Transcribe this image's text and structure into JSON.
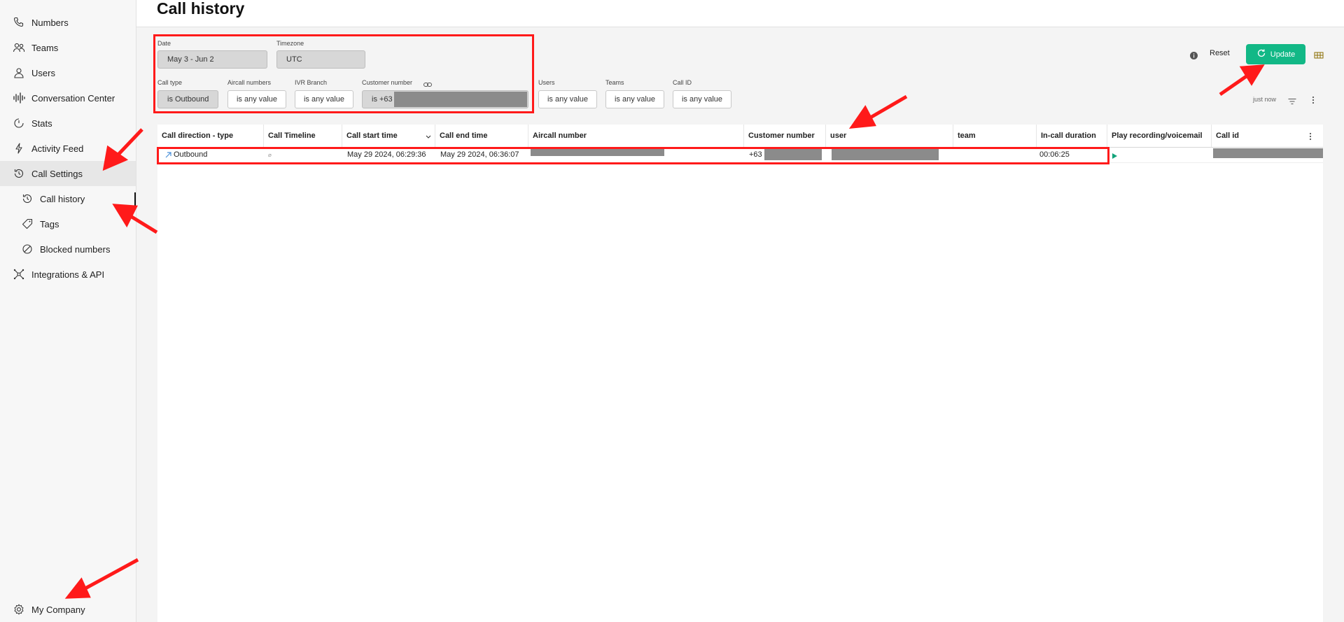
{
  "sidebar": {
    "items": [
      {
        "label": "Numbers",
        "icon": "phone-icon"
      },
      {
        "label": "Teams",
        "icon": "team-icon"
      },
      {
        "label": "Users",
        "icon": "user-icon"
      },
      {
        "label": "Conversation Center",
        "icon": "waveform-icon"
      },
      {
        "label": "Stats",
        "icon": "stats-icon"
      },
      {
        "label": "Activity Feed",
        "icon": "bolt-icon"
      },
      {
        "label": "Call Settings",
        "icon": "history-icon"
      },
      {
        "label": "Call history",
        "icon": "history-icon"
      },
      {
        "label": "Tags",
        "icon": "tag-icon"
      },
      {
        "label": "Blocked numbers",
        "icon": "blocked-icon"
      },
      {
        "label": "Integrations & API",
        "icon": "integration-icon"
      }
    ],
    "footer": {
      "label": "My Company",
      "icon": "gear-icon"
    }
  },
  "header": {
    "title": "Call history"
  },
  "filters": {
    "date": {
      "label": "Date",
      "value": "May 3 - Jun 2"
    },
    "timezone": {
      "label": "Timezone",
      "value": "UTC"
    },
    "call_type": {
      "label": "Call type",
      "value": "is Outbound"
    },
    "aircall_numbers": {
      "label": "Aircall numbers",
      "value": "is any value"
    },
    "ivr_branch": {
      "label": "IVR Branch",
      "value": "is any value"
    },
    "customer_number": {
      "label": "Customer number",
      "value": "is +63"
    },
    "users": {
      "label": "Users",
      "value": "is any value"
    },
    "teams": {
      "label": "Teams",
      "value": "is any value"
    },
    "call_id": {
      "label": "Call ID",
      "value": "is any value"
    }
  },
  "toolbar": {
    "reset_label": "Reset",
    "update_label": "Update",
    "refresh_status": "just now"
  },
  "table": {
    "columns": [
      "Call direction - type",
      "Call Timeline",
      "Call start time",
      "Call end time",
      "Aircall number",
      "Customer number",
      "user",
      "team",
      "In-call duration",
      "Play recording/voicemail",
      "Call id"
    ],
    "rows": [
      {
        "direction": "Outbound",
        "start": "May 29 2024, 06:29:36",
        "end": "May 29 2024, 06:36:07",
        "customer": "+63",
        "duration": "00:06:25"
      }
    ]
  },
  "colors": {
    "accent": "#12b886",
    "annotation": "#ff1a1a"
  }
}
